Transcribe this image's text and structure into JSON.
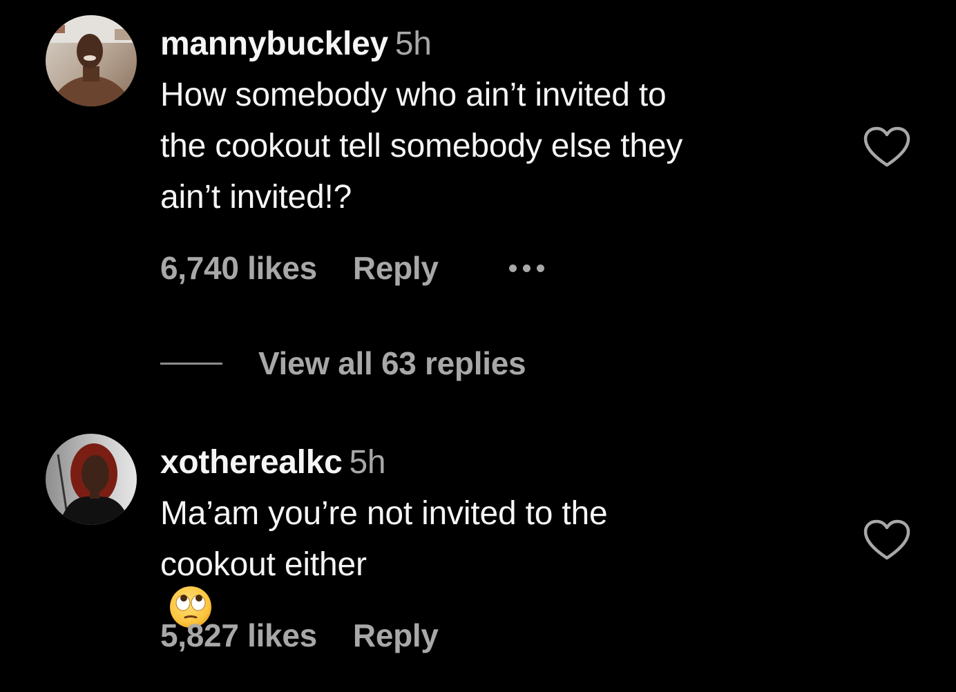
{
  "comments": [
    {
      "username": "mannybuckley",
      "time": "5h",
      "text_lines": [
        "How somebody who ain’t invited to",
        "the cookout tell somebody else they",
        "ain’t invited!?"
      ],
      "likes": "6,740 likes",
      "reply_label": "Reply",
      "more_icon": "more-options-icon",
      "like_icon": "heart-outline-icon",
      "avatar_icon": "avatar-photo"
    },
    {
      "username": "xotherealkc",
      "time": "5h",
      "text_lines": [
        "Ma’am you’re not invited to the",
        "cookout either"
      ],
      "emoji": "face-with-rolling-eyes",
      "likes": "5,827 likes",
      "reply_label": "Reply",
      "like_icon": "heart-outline-icon",
      "avatar_icon": "avatar-photo"
    }
  ],
  "view_replies": {
    "label": "View all 63 replies"
  },
  "colors": {
    "background": "#000000",
    "primary_text": "#f5f5f5",
    "secondary_text": "#a8a8a8",
    "reply_line": "#8e8e8e"
  }
}
